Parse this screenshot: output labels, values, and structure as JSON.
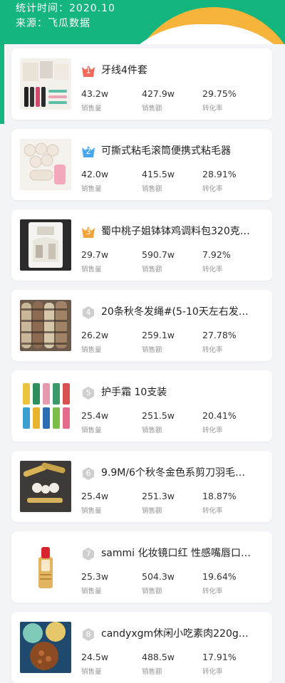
{
  "header": {
    "stat_time": "统计时间：2020.10",
    "source": "来源：飞瓜数据"
  },
  "colors": {
    "brand_green": "#14b57e",
    "accent_yellow": "#f6b43a",
    "rank_gold": "#f0a43a",
    "rank_red": "#f0695a",
    "rank_blue": "#4aa7ef",
    "rank_gray": "#cfcfcf"
  },
  "metric_labels": {
    "sales_volume": "销售量",
    "sales_amount": "销售额",
    "conversion": "转化率"
  },
  "products": [
    {
      "rank": "1",
      "rank_icon": "crown-red-icon",
      "title": "牙线4件套",
      "sales_volume": "43.2w",
      "sales_amount": "427.9w",
      "conversion": "29.75%"
    },
    {
      "rank": "2",
      "rank_icon": "crown-blue-icon",
      "title": "可撕式粘毛滚筒便携式粘毛器",
      "sales_volume": "42.0w",
      "sales_amount": "415.5w",
      "conversion": "28.91%"
    },
    {
      "rank": "3",
      "rank_icon": "crown-gold-icon",
      "title": "蜀中桃子姐钵钵鸡调料包320克…",
      "sales_volume": "29.7w",
      "sales_amount": "590.7w",
      "conversion": "7.92%"
    },
    {
      "rank": "4",
      "rank_icon": "hexagon-icon",
      "title": "20条秋冬发绳#(5-10天左右发…",
      "sales_volume": "26.2w",
      "sales_amount": "259.1w",
      "conversion": "27.78%"
    },
    {
      "rank": "5",
      "rank_icon": "hexagon-icon",
      "title": "护手霜 10支装",
      "sales_volume": "25.4w",
      "sales_amount": "251.5w",
      "conversion": "20.41%"
    },
    {
      "rank": "6",
      "rank_icon": "hexagon-icon",
      "title": "9.9M/6个秋冬金色系剪刀羽毛…",
      "sales_volume": "25.4w",
      "sales_amount": "251.3w",
      "conversion": "18.87%"
    },
    {
      "rank": "7",
      "rank_icon": "hexagon-icon",
      "title": "sammi 化妆镜口红 性感嘴唇口…",
      "sales_volume": "25.3w",
      "sales_amount": "504.3w",
      "conversion": "19.64%"
    },
    {
      "rank": "8",
      "rank_icon": "hexagon-icon",
      "title": "candyxgm休闲小吃素肉220g…",
      "sales_volume": "24.5w",
      "sales_amount": "488.5w",
      "conversion": "17.91%"
    }
  ]
}
